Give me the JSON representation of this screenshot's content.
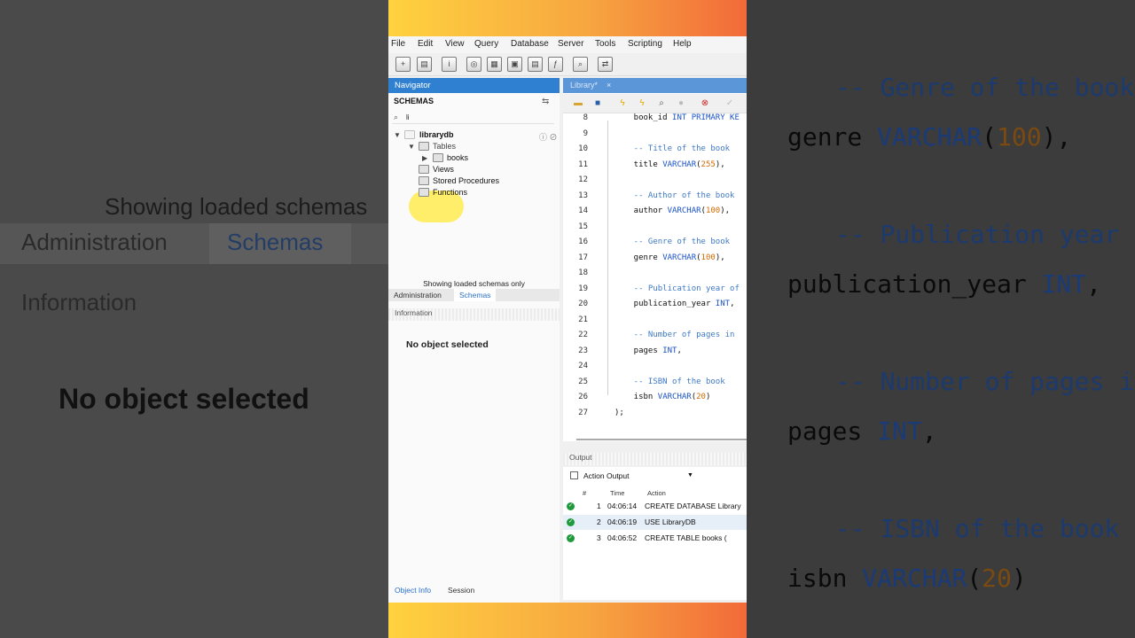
{
  "background": {
    "left": {
      "showing": "Showing loaded schemas",
      "tab_admin": "Administration",
      "tab_schemas": "Schemas",
      "info": "Information",
      "no_object": "No object selected"
    },
    "right": {
      "line1": "-- Genre of the book",
      "line2_a": "genre ",
      "line2_kw": "VARCHAR",
      "line2_b": "(",
      "line2_num": "100",
      "line2_c": "),",
      "line3": "-- Publication year of",
      "line4_a": "publication_year ",
      "line4_kw": "INT",
      "line4_b": ",",
      "line5": "-- Number of pages in",
      "line6_a": "pages ",
      "line6_kw": "INT",
      "line6_b": ",",
      "line7": "-- ISBN of the book",
      "line8_a": "isbn ",
      "line8_kw": "VARCHAR",
      "line8_b": "(",
      "line8_num": "20",
      "line8_c": ")"
    }
  },
  "menu": [
    "File",
    "Edit",
    "View",
    "Query",
    "Database",
    "Server",
    "Tools",
    "Scripting",
    "Help"
  ],
  "navigator": {
    "title": "Navigator",
    "schemas_label": "SCHEMAS",
    "search_value": "li",
    "tree": {
      "db": "librarydb",
      "tables": "Tables",
      "books": "books",
      "views": "Views",
      "procedures": "Stored Procedures",
      "functions": "Functions"
    },
    "showing": "Showing loaded schemas only",
    "tab_admin": "Administration",
    "tab_schemas": "Schemas",
    "info_label": "Information",
    "no_object": "No object selected",
    "bottom_tab_info": "Object Info",
    "bottom_tab_session": "Session"
  },
  "editor": {
    "tab_label": "Library*",
    "tab_close": "×",
    "lines": [
      {
        "n": "8",
        "a": "    book_id ",
        "kw": "INT PRIMARY KE",
        "b": ""
      },
      {
        "n": "9",
        "a": "",
        "kw": "",
        "b": ""
      },
      {
        "n": "10",
        "cm": "    -- Title of the book"
      },
      {
        "n": "11",
        "a": "    title ",
        "kw": "VARCHAR",
        "b": "(",
        "num": "255",
        "c": "),"
      },
      {
        "n": "12",
        "a": "",
        "kw": "",
        "b": ""
      },
      {
        "n": "13",
        "cm": "    -- Author of the book"
      },
      {
        "n": "14",
        "a": "    author ",
        "kw": "VARCHAR",
        "b": "(",
        "num": "100",
        "c": "),"
      },
      {
        "n": "15",
        "a": "",
        "kw": "",
        "b": ""
      },
      {
        "n": "16",
        "cm": "    -- Genre of the book"
      },
      {
        "n": "17",
        "a": "    genre ",
        "kw": "VARCHAR",
        "b": "(",
        "num": "100",
        "c": "),"
      },
      {
        "n": "18",
        "a": "",
        "kw": "",
        "b": ""
      },
      {
        "n": "19",
        "cm": "    -- Publication year of"
      },
      {
        "n": "20",
        "a": "    publication_year ",
        "kw": "INT",
        "b": ","
      },
      {
        "n": "21",
        "a": "",
        "kw": "",
        "b": ""
      },
      {
        "n": "22",
        "cm": "    -- Number of pages in"
      },
      {
        "n": "23",
        "a": "    pages ",
        "kw": "INT",
        "b": ","
      },
      {
        "n": "24",
        "a": "",
        "kw": "",
        "b": ""
      },
      {
        "n": "25",
        "cm": "    -- ISBN of the book"
      },
      {
        "n": "26",
        "a": "    isbn ",
        "kw": "VARCHAR",
        "b": "(",
        "num": "20",
        "c": ")"
      },
      {
        "n": "27",
        "a": ");",
        "kw": "",
        "b": ""
      }
    ]
  },
  "output": {
    "label": "Output",
    "selector": "Action Output",
    "col_num": "#",
    "col_time": "Time",
    "col_action": "Action",
    "rows": [
      {
        "num": "1",
        "time": "04:06:14",
        "action": "CREATE DATABASE Library"
      },
      {
        "num": "2",
        "time": "04:06:19",
        "action": "USE LibraryDB"
      },
      {
        "num": "3",
        "time": "04:06:52",
        "action": "CREATE TABLE books (  "
      }
    ]
  }
}
